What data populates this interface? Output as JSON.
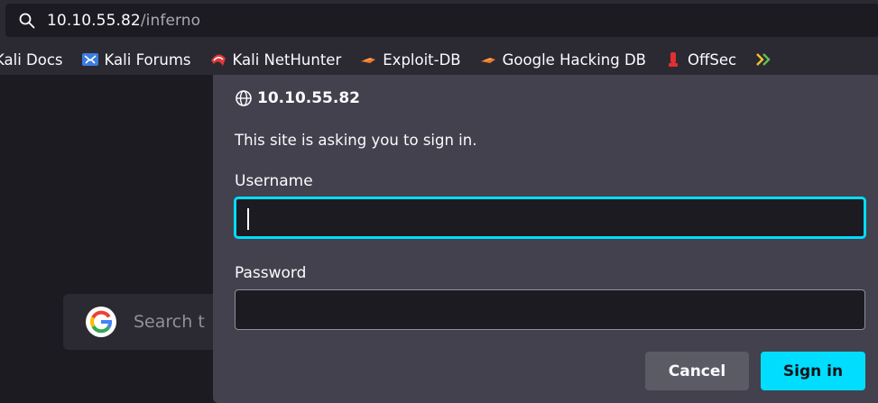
{
  "urlbar": {
    "host": "10.10.55.82",
    "path": "/inferno",
    "icon": "search-icon"
  },
  "bookmarks": [
    {
      "label": "Kali Docs",
      "icon": "kali-docs-icon"
    },
    {
      "label": "Kali Forums",
      "icon": "kali-forums-icon"
    },
    {
      "label": "Kali NetHunter",
      "icon": "kali-nethunter-icon"
    },
    {
      "label": "Exploit-DB",
      "icon": "exploit-db-icon"
    },
    {
      "label": "Google Hacking DB",
      "icon": "google-hacking-db-icon"
    },
    {
      "label": "OffSec",
      "icon": "offsec-icon"
    }
  ],
  "page": {
    "search_placeholder": "Search t"
  },
  "dialog": {
    "host": "10.10.55.82",
    "message": "This site is asking you to sign in.",
    "username_label": "Username",
    "username_value": "",
    "password_label": "Password",
    "password_value": "",
    "cancel_label": "Cancel",
    "signin_label": "Sign in"
  },
  "colors": {
    "accent": "#00ddff",
    "dialog_bg": "#42414d",
    "toolbar_bg": "#2b2a33",
    "page_bg": "#1c1b22"
  }
}
